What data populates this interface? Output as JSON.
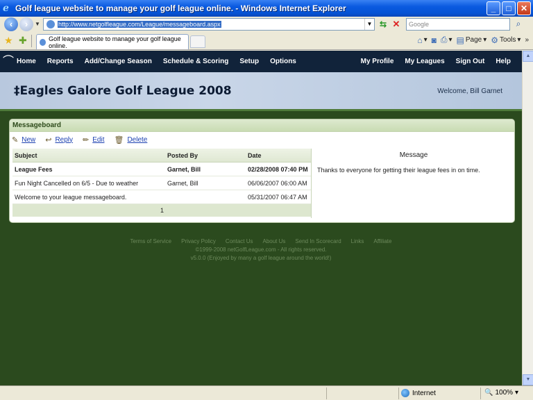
{
  "window": {
    "title": "Golf league website to manage your golf league online. - Windows Internet Explorer",
    "minimize": "_",
    "maximize": "□",
    "close": "✕"
  },
  "address_bar": {
    "url": "http://www.netgolfleague.com/League/messageboard.aspx",
    "search_placeholder": "Google"
  },
  "tab": {
    "label": "Golf league website to manage your golf league online."
  },
  "command_bar": {
    "page_label": "Page",
    "tools_label": "Tools",
    "more": "»"
  },
  "nav": {
    "left": [
      "Home",
      "Reports",
      "Add/Change Season",
      "Schedule & Scoring",
      "Setup",
      "Options"
    ],
    "right": [
      "My Profile",
      "My Leagues",
      "Sign Out",
      "Help"
    ]
  },
  "header": {
    "title": "‡Eagles Galore Golf League 2008",
    "welcome": "Welcome, Bill Garnet"
  },
  "messageboard": {
    "panel_title": "Messageboard",
    "actions": {
      "new": "New",
      "reply": "Reply",
      "edit": "Edit",
      "delete": "Delete"
    },
    "columns": {
      "subject": "Subject",
      "posted_by": "Posted By",
      "date": "Date"
    },
    "rows": [
      {
        "subject": "League Fees",
        "posted_by": "Garnet, Bill",
        "date": "02/28/2008 07:40 PM"
      },
      {
        "subject": "Fun Night Cancelled on 6/5 - Due to weather",
        "posted_by": "Garnet, Bill",
        "date": "06/06/2007 06:00 AM"
      },
      {
        "subject": "Welcome to your league messageboard.",
        "posted_by": "",
        "date": "05/31/2007 06:47 AM"
      }
    ],
    "pager": "1",
    "message_header": "Message",
    "message_body": "Thanks to everyone for getting their league fees in on time."
  },
  "footer": {
    "links": [
      "Terms of Service",
      "Privacy Policy",
      "Contact Us",
      "About Us",
      "Send In Scorecard",
      "Links",
      "Affiliate"
    ],
    "copyright": "©1999-2008 netGolfLeague.com - All rights reserved.",
    "version": "v5.0.0 (Enjoyed by many a golf league around the world!)"
  },
  "status_bar": {
    "zone": "Internet",
    "zoom": "100%"
  }
}
